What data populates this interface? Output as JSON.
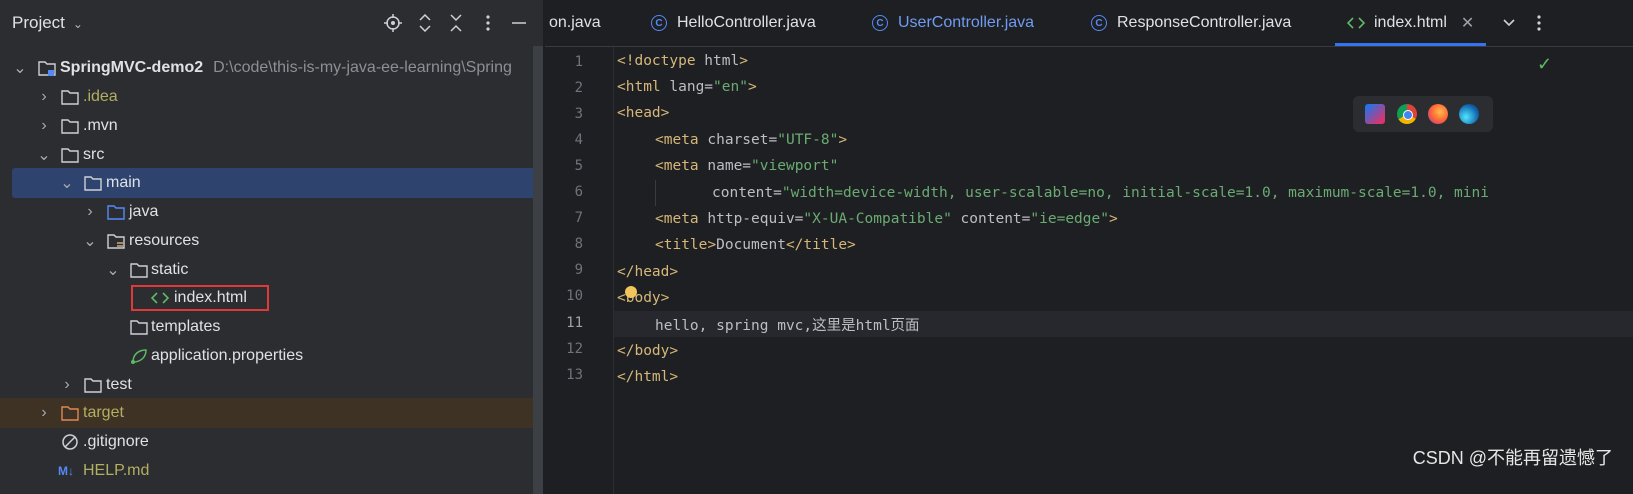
{
  "sidebar": {
    "title": "Project",
    "tree": [
      {
        "label": "SpringMVC-demo2",
        "path": "D:\\code\\this-is-my-java-ee-learning\\Spring",
        "icon": "module-folder-icon"
      },
      {
        "label": ".idea",
        "icon": "folder-icon"
      },
      {
        "label": ".mvn",
        "icon": "folder-icon"
      },
      {
        "label": "src",
        "icon": "folder-icon"
      },
      {
        "label": "main",
        "icon": "folder-icon"
      },
      {
        "label": "java",
        "icon": "source-folder-icon"
      },
      {
        "label": "resources",
        "icon": "resources-folder-icon"
      },
      {
        "label": "static",
        "icon": "folder-icon"
      },
      {
        "label": "index.html",
        "icon": "html-file-icon"
      },
      {
        "label": "templates",
        "icon": "folder-icon"
      },
      {
        "label": "application.properties",
        "icon": "properties-file-icon"
      },
      {
        "label": "test",
        "icon": "folder-icon"
      },
      {
        "label": "target",
        "icon": "excluded-folder-icon"
      },
      {
        "label": ".gitignore",
        "icon": "ignore-file-icon"
      },
      {
        "label": "HELP.md",
        "icon": "markdown-file-icon"
      }
    ]
  },
  "tabs": [
    {
      "label": "on.java"
    },
    {
      "label": "HelloController.java"
    },
    {
      "label": "UserController.java"
    },
    {
      "label": "ResponseController.java"
    },
    {
      "label": "index.html"
    }
  ],
  "editor": {
    "line_numbers": [
      "1",
      "2",
      "3",
      "4",
      "5",
      "6",
      "7",
      "8",
      "9",
      "10",
      "11",
      "12",
      "13"
    ],
    "code": {
      "l1_tag": "<!doctype",
      "l1_attr": " html",
      "l1_end": ">",
      "l2_tag": "<html",
      "l2_attr": " lang=",
      "l2_val": "\"en\"",
      "l2_end": ">",
      "l3": "<head>",
      "l4_tag": "<meta",
      "l4_attr": " charset=",
      "l4_val": "\"UTF-8\"",
      "l4_end": ">",
      "l5_tag": "<meta",
      "l5_attr": " name=",
      "l5_val": "\"viewport\"",
      "l6_attr": "content=",
      "l6_val": "\"width=device-width, user-scalable=no, initial-scale=1.0, maximum-scale=1.0, mini",
      "l7_tag": "<meta",
      "l7_attr": " http-equiv=",
      "l7_val": "\"X-UA-Compatible\"",
      "l7_attr2": " content=",
      "l7_val2": "\"ie=edge\"",
      "l7_end": ">",
      "l8_tag": "<title>",
      "l8_txt": "Document",
      "l8_end": "</title>",
      "l9": "</head>",
      "l10": "<body>",
      "l11": "hello, spring mvc,这里是html页面",
      "l12": "</body>",
      "l13": "</html>"
    }
  },
  "watermark": "CSDN @不能再留遗憾了",
  "colors": {
    "accent": "#3574f0",
    "selection": "#2e436e",
    "highlight_box": "#e0393a"
  }
}
